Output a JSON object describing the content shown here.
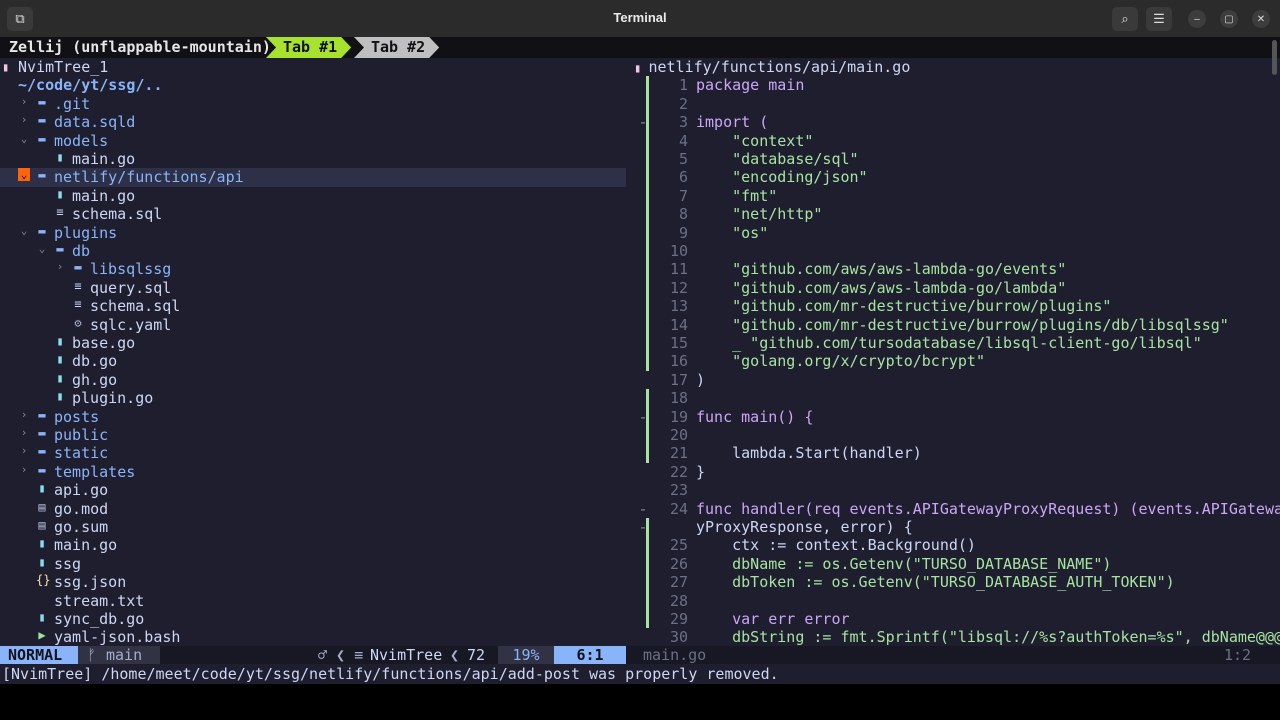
{
  "window": {
    "title": "Terminal"
  },
  "zellij": {
    "session": "Zellij (unflappable-mountain)",
    "tab1": "Tab #1",
    "tab2": "Tab #2"
  },
  "tree": {
    "header": "NvimTree_1",
    "root": "~/code/yt/ssg/..",
    "items": [
      {
        "label": ".git"
      },
      {
        "label": "data.sqld"
      },
      {
        "label": "models"
      },
      {
        "label": "main.go"
      },
      {
        "label": "netlify/functions/api"
      },
      {
        "label": "main.go"
      },
      {
        "label": "schema.sql"
      },
      {
        "label": "plugins"
      },
      {
        "label": "db"
      },
      {
        "label": "libsqlssg"
      },
      {
        "label": "query.sql"
      },
      {
        "label": "schema.sql"
      },
      {
        "label": "sqlc.yaml"
      },
      {
        "label": "base.go"
      },
      {
        "label": "db.go"
      },
      {
        "label": "gh.go"
      },
      {
        "label": "plugin.go"
      },
      {
        "label": "posts"
      },
      {
        "label": "public"
      },
      {
        "label": "static"
      },
      {
        "label": "templates"
      },
      {
        "label": "api.go"
      },
      {
        "label": "go.mod"
      },
      {
        "label": "go.sum"
      },
      {
        "label": "main.go"
      },
      {
        "label": "ssg"
      },
      {
        "label": "ssg.json"
      },
      {
        "label": "stream.txt"
      },
      {
        "label": "sync_db.go"
      },
      {
        "label": "yaml-json.bash"
      }
    ]
  },
  "editor": {
    "file": "netlify/functions/api/main.go",
    "lines": [
      {
        "n": "1",
        "t": "package main"
      },
      {
        "n": "2",
        "t": ""
      },
      {
        "n": "3",
        "t": "import ("
      },
      {
        "n": "4",
        "t": "    \"context\""
      },
      {
        "n": "5",
        "t": "    \"database/sql\""
      },
      {
        "n": "6",
        "t": "    \"encoding/json\""
      },
      {
        "n": "7",
        "t": "    \"fmt\""
      },
      {
        "n": "8",
        "t": "    \"net/http\""
      },
      {
        "n": "9",
        "t": "    \"os\""
      },
      {
        "n": "10",
        "t": ""
      },
      {
        "n": "11",
        "t": "    \"github.com/aws/aws-lambda-go/events\""
      },
      {
        "n": "12",
        "t": "    \"github.com/aws/aws-lambda-go/lambda\""
      },
      {
        "n": "13",
        "t": "    \"github.com/mr-destructive/burrow/plugins\""
      },
      {
        "n": "14",
        "t": "    \"github.com/mr-destructive/burrow/plugins/db/libsqlssg\""
      },
      {
        "n": "15",
        "t": "    _ \"github.com/tursodatabase/libsql-client-go/libsql\""
      },
      {
        "n": "16",
        "t": "    \"golang.org/x/crypto/bcrypt\""
      },
      {
        "n": "17",
        "t": ")"
      },
      {
        "n": "18",
        "t": ""
      },
      {
        "n": "19",
        "t": "func main() {"
      },
      {
        "n": "20",
        "t": ""
      },
      {
        "n": "21",
        "t": "    lambda.Start(handler)"
      },
      {
        "n": "22",
        "t": "}"
      },
      {
        "n": "23",
        "t": ""
      },
      {
        "n": "24",
        "t": "func handler(req events.APIGatewayProxyRequest) (events.APIGatewa"
      },
      {
        "n": "",
        "t": "yProxyResponse, error) {"
      },
      {
        "n": "25",
        "t": "    ctx := context.Background()"
      },
      {
        "n": "26",
        "t": "    dbName := os.Getenv(\"TURSO_DATABASE_NAME\")"
      },
      {
        "n": "27",
        "t": "    dbToken := os.Getenv(\"TURSO_DATABASE_AUTH_TOKEN\")"
      },
      {
        "n": "28",
        "t": ""
      },
      {
        "n": "29",
        "t": "    var err error"
      },
      {
        "n": "30",
        "t": "    dbString := fmt.Sprintf(\"libsql://%s?authToken=%s\", dbName@@@"
      }
    ]
  },
  "status": {
    "mode": "NORMAL",
    "branch": "main",
    "center": "NvimTree",
    "lines": "72",
    "percent": "19%",
    "pos": "6:1",
    "right_file": "main.go",
    "right_pos": "1:2"
  },
  "cmdline": "[NvimTree] /home/meet/code/yt/ssg/netlify/functions/api/add-post was properly removed.",
  "colors": {
    "tab_active": "#a6e22e",
    "tab_inactive": "#bfbfbf",
    "mode_bg": "#89b4fa",
    "git_added": "#a6e3a1"
  }
}
